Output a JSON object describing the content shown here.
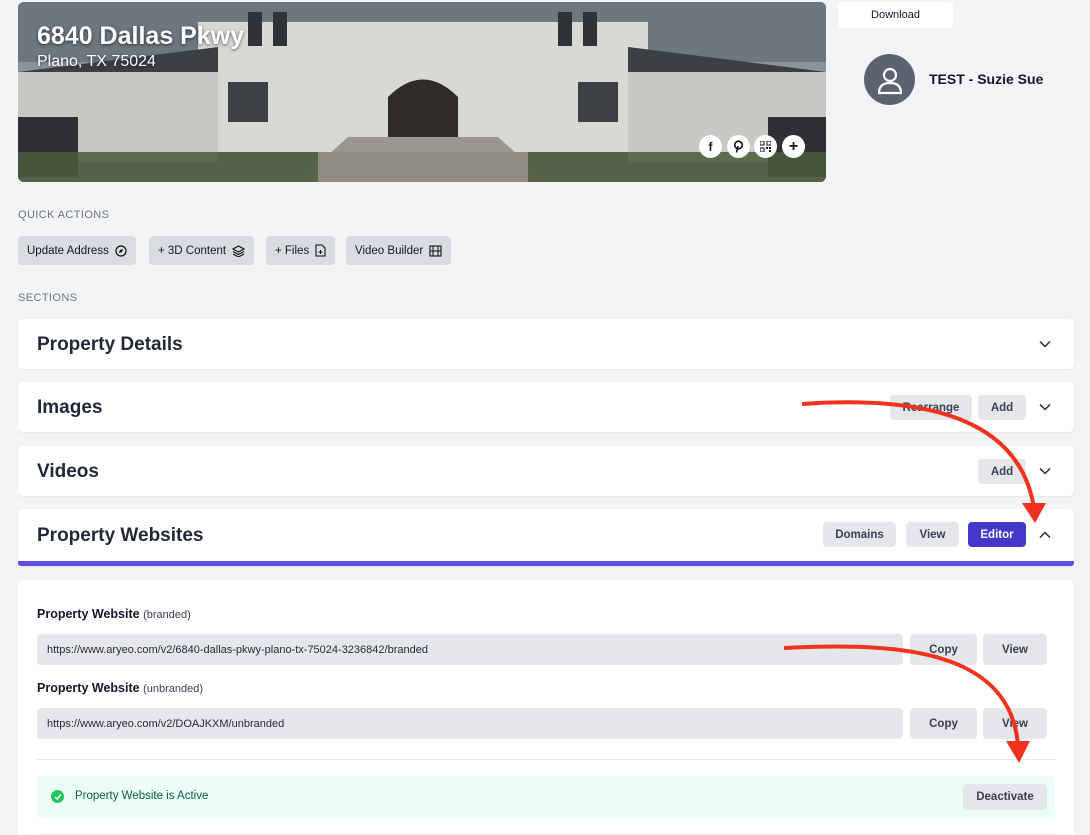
{
  "hero": {
    "address_line1": "6840 Dallas Pkwy",
    "address_line2": "Plano, TX 75024",
    "social_icons": [
      "facebook-icon",
      "pinterest-icon",
      "qr-code-icon",
      "plus-icon"
    ]
  },
  "download_label": "Download",
  "user": {
    "name": "TEST - Suzie Sue"
  },
  "quick_actions": {
    "heading": "QUICK ACTIONS",
    "items": [
      {
        "label": "Update Address",
        "icon": "compass-icon"
      },
      {
        "label": "+ 3D Content",
        "icon": "layers-icon"
      },
      {
        "label": "+ Files",
        "icon": "file-icon"
      },
      {
        "label": "Video Builder",
        "icon": "film-icon"
      }
    ]
  },
  "sections": {
    "heading": "SECTIONS",
    "property_details": {
      "title": "Property Details"
    },
    "images": {
      "title": "Images",
      "rearrange": "Rearrange",
      "add": "Add"
    },
    "videos": {
      "title": "Videos",
      "add": "Add"
    },
    "property_websites": {
      "title": "Property Websites",
      "domains": "Domains",
      "view": "View",
      "editor": "Editor"
    }
  },
  "websites": {
    "branded": {
      "label": "Property Website",
      "sub": "(branded)",
      "url": "https://www.aryeo.com/v2/6840-dallas-pkwy-plano-tx-75024-3236842/branded",
      "copy": "Copy",
      "view": "View"
    },
    "unbranded": {
      "label": "Property Website",
      "sub": "(unbranded)",
      "url": "https://www.aryeo.com/v2/DOAJKXM/unbranded",
      "copy": "Copy",
      "view": "View"
    },
    "status_text": "Property Website is Active",
    "deactivate": "Deactivate"
  },
  "colors": {
    "accent": "#4338ca",
    "underline": "#5b4fe0",
    "arrow": "#f0321e",
    "active_bg": "#ecfdf5"
  }
}
